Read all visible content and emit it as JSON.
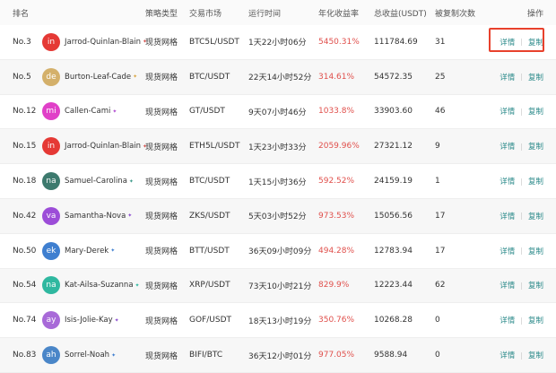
{
  "columns": {
    "rank": "排名",
    "type": "策略类型",
    "market": "交易市场",
    "time": "运行时间",
    "apy": "年化收益率",
    "total": "总收益(USDT)",
    "copies": "被复制次数",
    "ops": "操作"
  },
  "actions": {
    "detail": "详情",
    "copy": "复制"
  },
  "rows": [
    {
      "rank": "No.3",
      "initials": "in",
      "color": "#e53935",
      "name": "Jarrod-Quinlan-Blain",
      "badge_color": "#d9534f",
      "type": "现货网格",
      "market": "BTC5L/USDT",
      "time": "1天22小时06分",
      "apy": "5450.31%",
      "total": "111784.69",
      "copies": "31"
    },
    {
      "rank": "No.5",
      "initials": "de",
      "color": "#d4b06a",
      "name": "Burton-Leaf-Cade",
      "badge_color": "#d9a441",
      "type": "现货网格",
      "market": "BTC/USDT",
      "time": "22天14小时52分",
      "apy": "314.61%",
      "total": "54572.35",
      "copies": "25"
    },
    {
      "rank": "No.12",
      "initials": "mi",
      "color": "#e040c8",
      "name": "Callen-Cami",
      "badge_color": "#b04ad0",
      "type": "现货网格",
      "market": "GT/USDT",
      "time": "9天07小时46分",
      "apy": "1033.8%",
      "total": "33903.60",
      "copies": "46"
    },
    {
      "rank": "No.15",
      "initials": "in",
      "color": "#e53935",
      "name": "Jarrod-Quinlan-Blain",
      "badge_color": "#d9534f",
      "type": "现货网格",
      "market": "ETH5L/USDT",
      "time": "1天23小时33分",
      "apy": "2059.96%",
      "total": "27321.12",
      "copies": "9"
    },
    {
      "rank": "No.18",
      "initials": "na",
      "color": "#3d7a6e",
      "name": "Samuel-Carolina",
      "badge_color": "#3d9a8a",
      "type": "现货网格",
      "market": "BTC/USDT",
      "time": "1天15小时36分",
      "apy": "592.52%",
      "total": "24159.19",
      "copies": "1"
    },
    {
      "rank": "No.42",
      "initials": "va",
      "color": "#9c4dd8",
      "name": "Samantha-Nova",
      "badge_color": "#8a4ad0",
      "type": "现货网格",
      "market": "ZKS/USDT",
      "time": "5天03小时52分",
      "apy": "973.53%",
      "total": "15056.56",
      "copies": "17"
    },
    {
      "rank": "No.50",
      "initials": "ek",
      "color": "#3f7fd0",
      "name": "Mary-Derek",
      "badge_color": "#3f7fd0",
      "type": "现货网格",
      "market": "BTT/USDT",
      "time": "36天09小时09分",
      "apy": "494.28%",
      "total": "12783.94",
      "copies": "17"
    },
    {
      "rank": "No.54",
      "initials": "na",
      "color": "#2fb8a0",
      "name": "Kat-Ailsa-Suzanna",
      "badge_color": "#2fb8a0",
      "type": "现货网格",
      "market": "XRP/USDT",
      "time": "73天10小时21分",
      "apy": "829.9%",
      "total": "12223.44",
      "copies": "62"
    },
    {
      "rank": "No.74",
      "initials": "ay",
      "color": "#a86ad8",
      "name": "Isis-Jolie-Kay",
      "badge_color": "#8a4ad0",
      "type": "现货网格",
      "market": "GOF/USDT",
      "time": "18天13小时19分",
      "apy": "350.76%",
      "total": "10268.28",
      "copies": "0"
    },
    {
      "rank": "No.83",
      "initials": "ah",
      "color": "#4a86c8",
      "name": "Sorrel-Noah",
      "badge_color": "#3f7fd0",
      "type": "现货网格",
      "market": "BIFI/BTC",
      "time": "36天12小时01分",
      "apy": "977.05%",
      "total": "9588.94",
      "copies": "0"
    }
  ]
}
